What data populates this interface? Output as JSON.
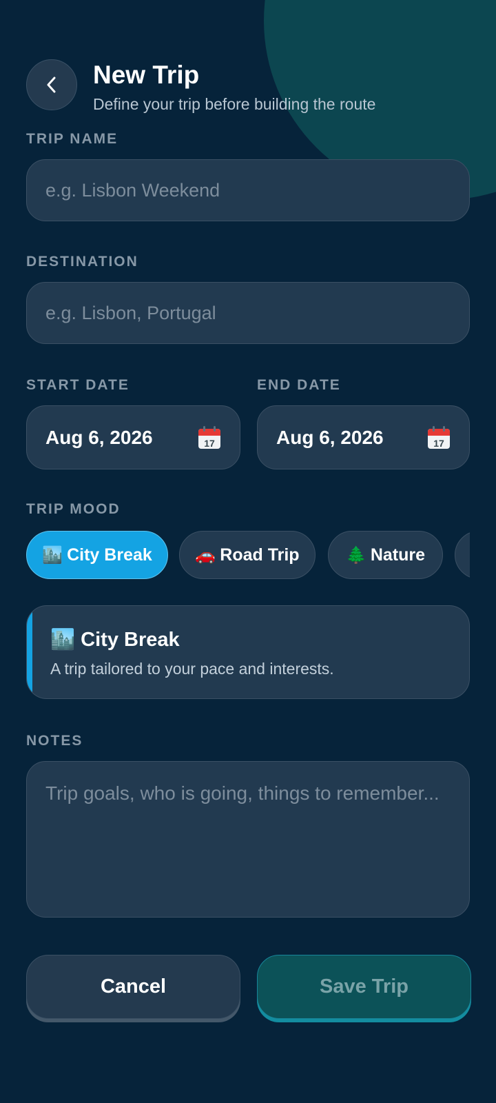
{
  "header": {
    "title": "New Trip",
    "subtitle": "Define your trip before building the route"
  },
  "trip_name": {
    "label": "TRIP NAME",
    "placeholder": "e.g. Lisbon Weekend",
    "value": ""
  },
  "destination": {
    "label": "DESTINATION",
    "placeholder": "e.g. Lisbon, Portugal",
    "value": ""
  },
  "start_date": {
    "label": "START DATE",
    "value": "Aug 6, 2026",
    "icon": "calendar-icon"
  },
  "end_date": {
    "label": "END DATE",
    "value": "Aug 6, 2026",
    "icon": "calendar-icon"
  },
  "mood": {
    "label": "TRIP MOOD",
    "chips": [
      {
        "emoji": "🏙️",
        "label": "City Break",
        "selected": true
      },
      {
        "emoji": "🚗",
        "label": "Road Trip",
        "selected": false
      },
      {
        "emoji": "🌲",
        "label": "Nature",
        "selected": false
      }
    ],
    "selected_card": {
      "emoji": "🏙️",
      "title": "City Break",
      "description": "A trip tailored to your pace and interests."
    }
  },
  "notes": {
    "label": "NOTES",
    "placeholder": "Trip goals, who is going, things to remember...",
    "value": ""
  },
  "actions": {
    "cancel_label": "Cancel",
    "save_label": "Save Trip"
  },
  "colors": {
    "background": "#06233a",
    "accent": "#14a3e3",
    "field": "#223a50",
    "save_button": "#0c5258"
  }
}
